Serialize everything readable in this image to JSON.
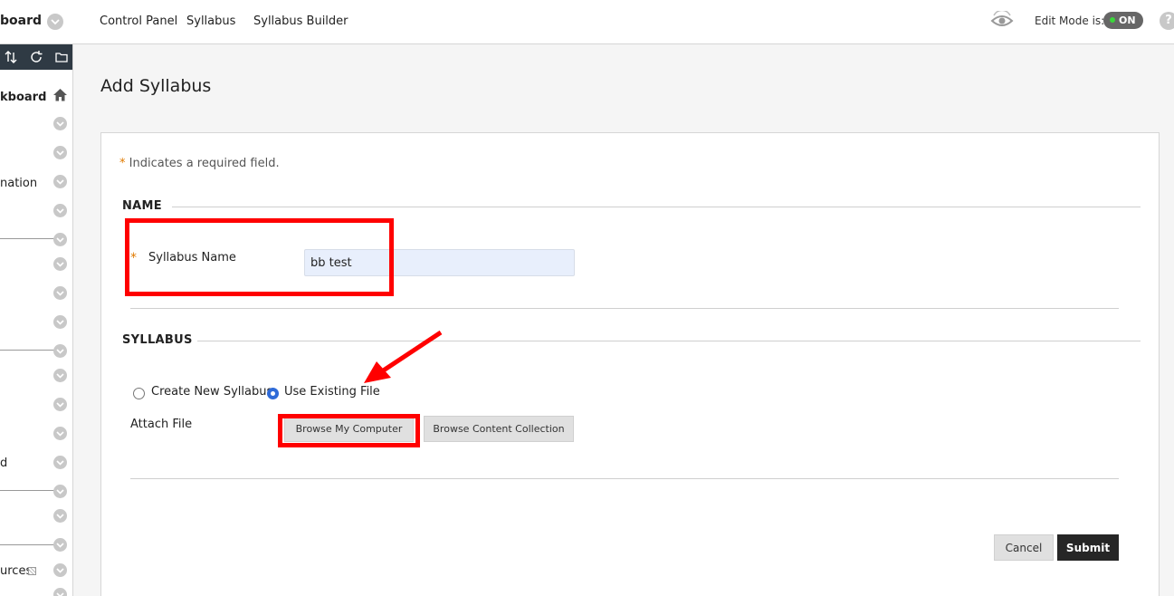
{
  "topbar": {
    "course_title": "board",
    "breadcrumbs": [
      "Control Panel",
      "Syllabus",
      "Syllabus Builder"
    ],
    "edit_mode_label": "Edit Mode is:",
    "edit_mode_value": "ON",
    "help_label": "?"
  },
  "sidebar": {
    "home_label": "kboard",
    "items": [
      "nation",
      "d",
      "urces"
    ]
  },
  "main": {
    "page_title": "Add Syllabus",
    "required_star": "*",
    "required_note": "Indicates a required field.",
    "name_section": {
      "heading": "NAME",
      "field_label": "Syllabus Name",
      "field_value": "bb test"
    },
    "syllabus_section": {
      "heading": "SYLLABUS",
      "options": [
        "Create New Syllabus",
        "Use Existing File"
      ],
      "selected_option": "Use Existing File",
      "attach_label": "Attach File",
      "browse_computer_label": "Browse My Computer",
      "browse_collection_label": "Browse Content Collection"
    },
    "cancel_label": "Cancel",
    "submit_label": "Submit"
  },
  "colors": {
    "toggle_on": "#3bd63b",
    "required_star": "#e07a00",
    "radio_selected": "#2f6bd8",
    "annotation": "#ff0000"
  }
}
